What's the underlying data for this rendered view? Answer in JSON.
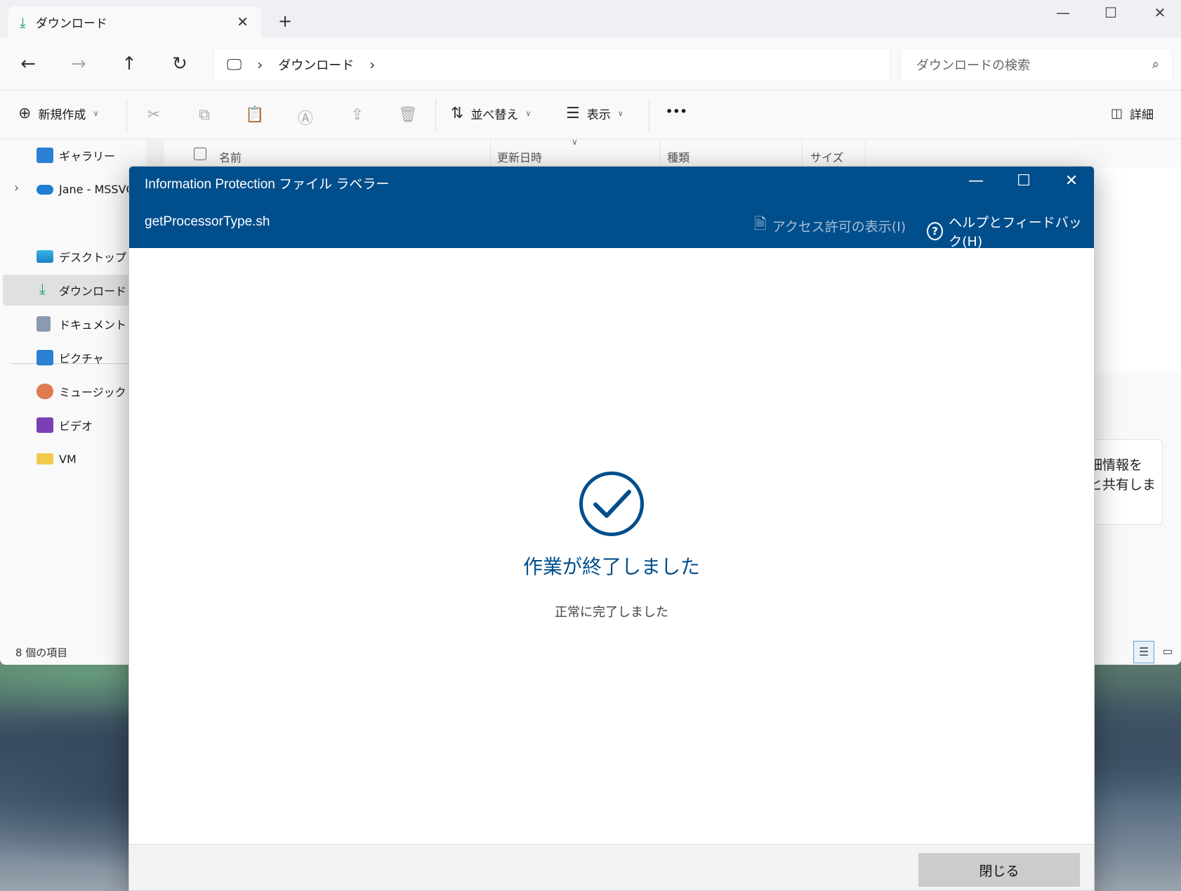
{
  "explorer": {
    "tab_title": "ダウンロード",
    "address": {
      "segment": "ダウンロード"
    },
    "search_placeholder": "ダウンロードの検索",
    "toolbar": {
      "new_label": "新規作成",
      "sort_label": "並べ替え",
      "view_label": "表示",
      "more_label": "•••",
      "details_label": "詳細"
    },
    "columns": {
      "name": "名前",
      "date": "更新日時",
      "type": "種類",
      "size": "サイズ"
    },
    "sidebar": {
      "items": [
        {
          "label": "ギャラリー"
        },
        {
          "label": "Jane - MSSVC"
        },
        {
          "label": "デスクトップ"
        },
        {
          "label": "ダウンロード"
        },
        {
          "label": "ドキュメント"
        },
        {
          "label": "ピクチャ"
        },
        {
          "label": "ミュージック"
        },
        {
          "label": "ビデオ"
        },
        {
          "label": "VM"
        }
      ]
    },
    "status": "8 個の項目",
    "right_card": {
      "line1": "細情報を",
      "line2": "と共有しま"
    }
  },
  "dialog": {
    "title": "Information Protection ファイル ラベラー",
    "file_name": "getProcessorType.sh",
    "view_permissions": "アクセス許可の表示(I)",
    "help_feedback": "ヘルプとフィードバック(H)",
    "message": "作業が終了しました",
    "sub_message": "正常に完了しました",
    "close_button": "閉じる"
  },
  "colors": {
    "dialog_header": "#004e8c",
    "accent": "#0067c0"
  }
}
